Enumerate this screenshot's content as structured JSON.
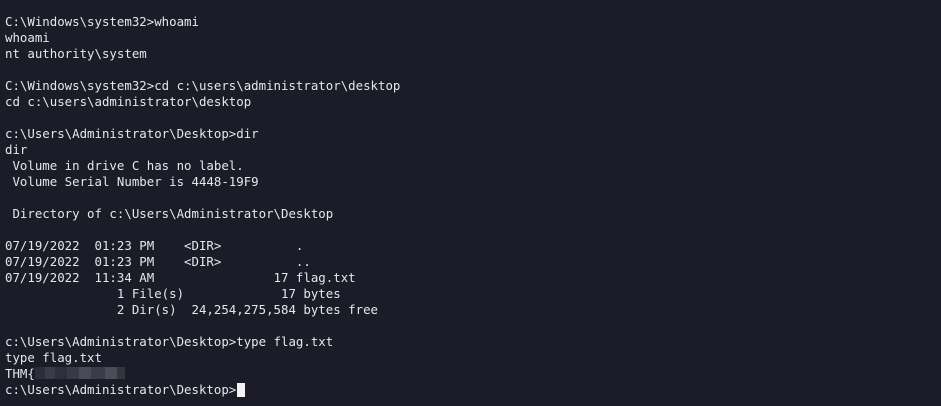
{
  "terminal": {
    "lines": [
      "C:\\Windows\\system32>whoami",
      "whoami",
      "nt authority\\system",
      "",
      "C:\\Windows\\system32>cd c:\\users\\administrator\\desktop",
      "cd c:\\users\\administrator\\desktop",
      "",
      "c:\\Users\\Administrator\\Desktop>dir",
      "dir",
      " Volume in drive C has no label.",
      " Volume Serial Number is 4448-19F9",
      "",
      " Directory of c:\\Users\\Administrator\\Desktop",
      "",
      "07/19/2022  01:23 PM    <DIR>          .",
      "07/19/2022  01:23 PM    <DIR>          ..",
      "07/19/2022  11:34 AM                17 flag.txt",
      "               1 File(s)             17 bytes",
      "               2 Dir(s)  24,254,275,584 bytes free",
      "",
      "c:\\Users\\Administrator\\Desktop>type flag.txt",
      "type flag.txt"
    ],
    "flag_prefix": "THM{",
    "final_prompt": "c:\\Users\\Administrator\\Desktop>"
  }
}
